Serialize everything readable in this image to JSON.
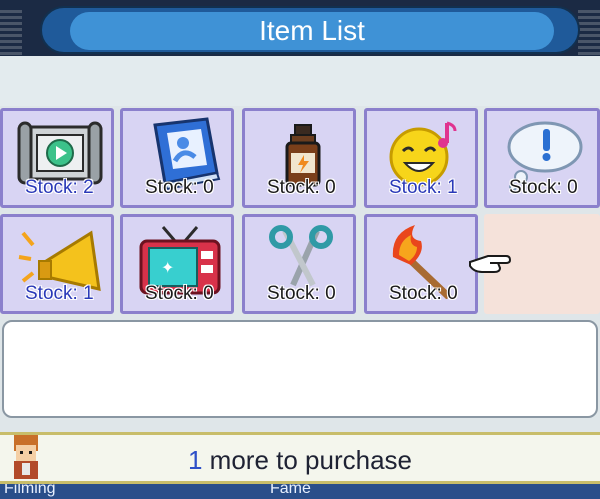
{
  "window": {
    "title": "Item List"
  },
  "items": [
    {
      "icon": "film-reel-icon",
      "stock_label": "Stock:",
      "stock": "2"
    },
    {
      "icon": "blue-book-icon",
      "stock_label": "Stock:",
      "stock": "0"
    },
    {
      "icon": "medicine-bottle-icon",
      "stock_label": "Stock:",
      "stock": "0"
    },
    {
      "icon": "happy-face-icon",
      "stock_label": "Stock:",
      "stock": "1"
    },
    {
      "icon": "thought-bubble-icon",
      "stock_label": "Stock:",
      "stock": "0"
    },
    {
      "icon": "megaphone-icon",
      "stock_label": "Stock:",
      "stock": "1"
    },
    {
      "icon": "television-icon",
      "stock_label": "Stock:",
      "stock": "0"
    },
    {
      "icon": "scissors-icon",
      "stock_label": "Stock:",
      "stock": "0"
    },
    {
      "icon": "torch-icon",
      "stock_label": "Stock:",
      "stock": "0"
    }
  ],
  "footer": {
    "count": "1",
    "text": " more to purchase"
  },
  "bottom_strip": {
    "left_text": "Filming",
    "mid_text": "Fame"
  }
}
